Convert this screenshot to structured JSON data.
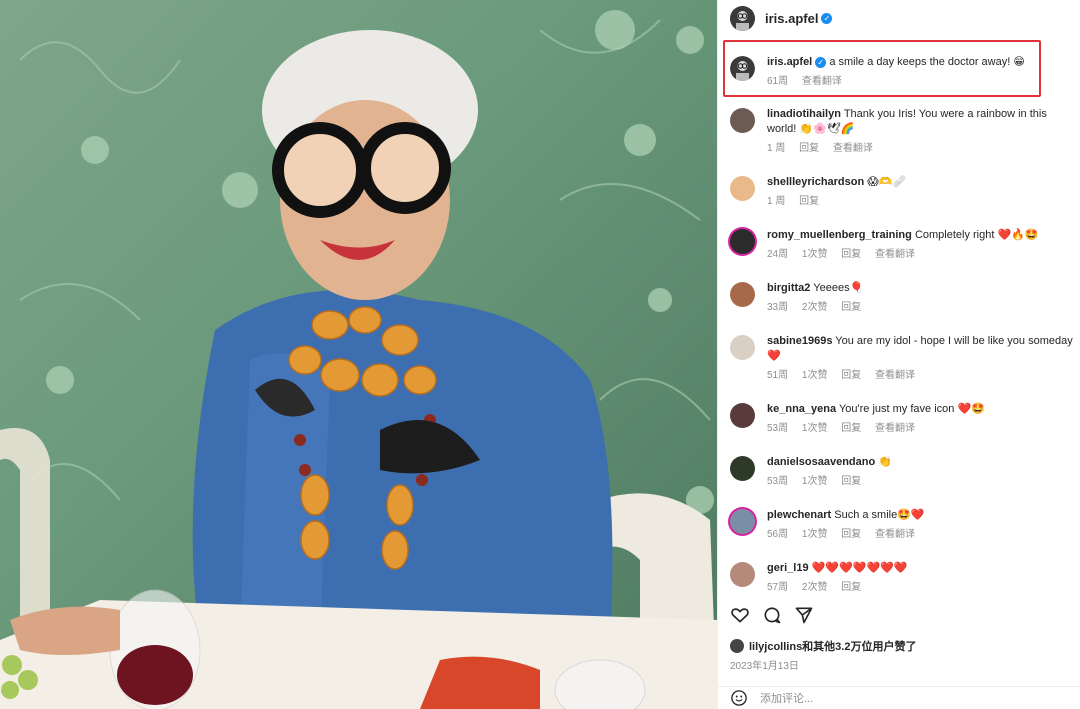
{
  "post": {
    "username": "iris.apfel",
    "caption": "a smile a day keeps the doctor away! 😁",
    "caption_time": "61周",
    "caption_translate": "查看翻译"
  },
  "comments": [
    {
      "user": "linadiotihailyn",
      "text": "Thank you Iris! You were a rainbow in this world! 👏🌸🕊🌈",
      "time": "1 周",
      "likes": "",
      "reply": "回复",
      "translate": "查看翻译"
    },
    {
      "user": "shellleyrichardson",
      "text": "😱🫶🩹",
      "time": "1 周",
      "likes": "",
      "reply": "回复",
      "translate": ""
    },
    {
      "user": "romy_muellenberg_training",
      "text": "Completely right ❤️🔥🤩",
      "time": "24周",
      "likes": "1次赞",
      "reply": "回复",
      "translate": "查看翻译"
    },
    {
      "user": "birgitta2",
      "text": "Yeeees🎈",
      "time": "33周",
      "likes": "2次赞",
      "reply": "回复",
      "translate": ""
    },
    {
      "user": "sabine1969s",
      "text": "You are my idol - hope I will be like you someday ❤️",
      "time": "51周",
      "likes": "1次赞",
      "reply": "回复",
      "translate": "查看翻译"
    },
    {
      "user": "ke_nna_yena",
      "text": "You're just my fave icon ❤️🤩",
      "time": "53周",
      "likes": "1次赞",
      "reply": "回复",
      "translate": "查看翻译"
    },
    {
      "user": "danielsosaavendano",
      "text": "👏",
      "time": "53周",
      "likes": "1次赞",
      "reply": "回复",
      "translate": ""
    },
    {
      "user": "plewchenart",
      "text": "Such a smile🤩❤️",
      "time": "56周",
      "likes": "1次赞",
      "reply": "回复",
      "translate": "查看翻译"
    },
    {
      "user": "geri_l19",
      "text": "❤️❤️❤️❤️❤️❤️❤️",
      "time": "57周",
      "likes": "2次赞",
      "reply": "回复",
      "translate": ""
    }
  ],
  "likes": {
    "text": "lilyjcollins和其他3.2万位用户赞了"
  },
  "date": "2023年1月13日",
  "add_comment_placeholder": "添加评论...",
  "colors": {
    "highlight": "#e0343b",
    "verified": "#1a8cf0",
    "meta_text": "#8e8e8e"
  }
}
